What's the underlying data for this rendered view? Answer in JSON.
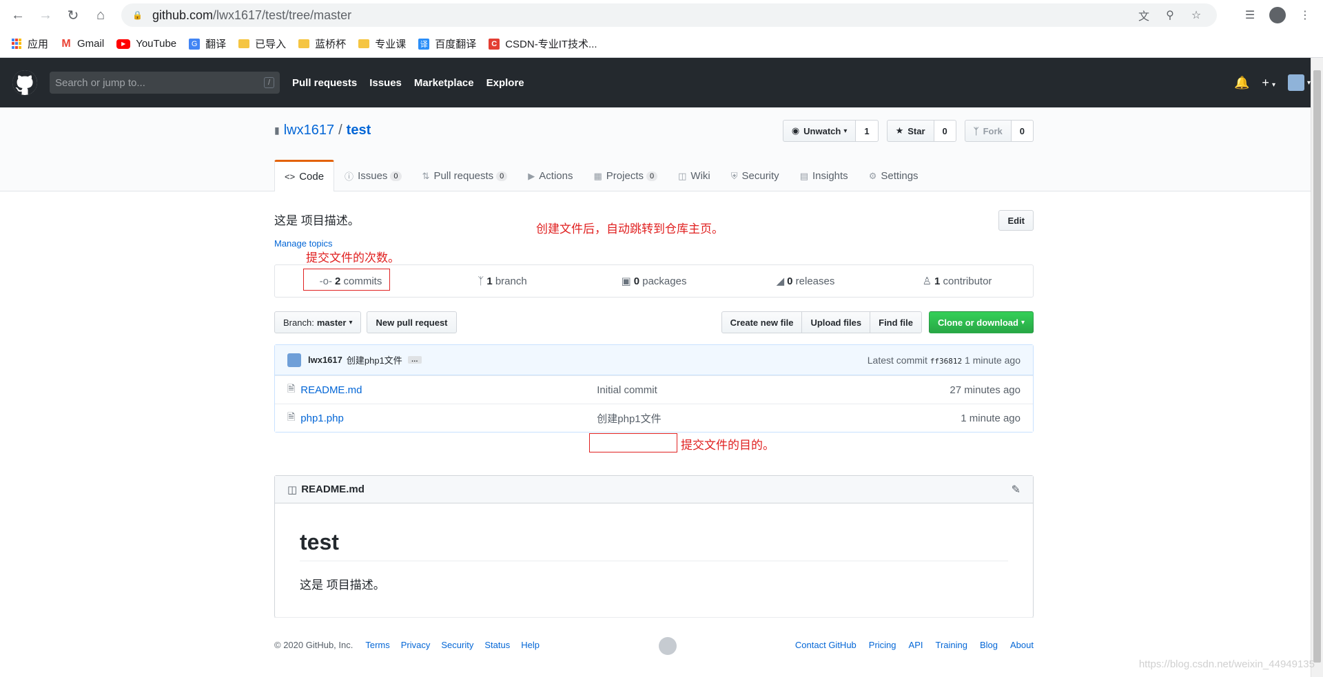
{
  "browser": {
    "url_host": "github.com",
    "url_path": "/lwx1617/test/tree/master",
    "bookmarks": [
      {
        "label": "应用",
        "icon": "apps-icon"
      },
      {
        "label": "Gmail",
        "icon": "gmail-icon"
      },
      {
        "label": "YouTube",
        "icon": "youtube-icon"
      },
      {
        "label": "翻译",
        "icon": "translate-icon"
      },
      {
        "label": "已导入",
        "icon": "folder-icon"
      },
      {
        "label": "蓝桥杯",
        "icon": "folder-icon"
      },
      {
        "label": "专业课",
        "icon": "folder-icon"
      },
      {
        "label": "百度翻译",
        "icon": "baidu-translate-icon"
      },
      {
        "label": "CSDN-专业IT技术...",
        "icon": "csdn-icon"
      }
    ]
  },
  "gh": {
    "search_placeholder": "Search or jump to...",
    "search_shortcut": "/",
    "nav": [
      "Pull requests",
      "Issues",
      "Marketplace",
      "Explore"
    ]
  },
  "repo": {
    "owner": "lwx1617",
    "separator": "/",
    "name": "test",
    "unwatch_label": "Unwatch",
    "watch_count": "1",
    "star_label": "Star",
    "star_count": "0",
    "fork_label": "Fork",
    "fork_count": "0",
    "tabs": {
      "code": "Code",
      "issues": "Issues",
      "issues_count": "0",
      "pulls": "Pull requests",
      "pulls_count": "0",
      "actions": "Actions",
      "projects": "Projects",
      "projects_count": "0",
      "wiki": "Wiki",
      "security": "Security",
      "insights": "Insights",
      "settings": "Settings"
    },
    "description": "这是 项目描述。",
    "edit_label": "Edit",
    "manage_topics": "Manage topics",
    "numbers": {
      "commits_n": "2",
      "commits_label": "commits",
      "branch_n": "1",
      "branch_label": "branch",
      "packages_n": "0",
      "packages_label": "packages",
      "releases_n": "0",
      "releases_label": "releases",
      "contributors_n": "1",
      "contributors_label": "contributor"
    },
    "branch_label": "Branch:",
    "branch_name": "master",
    "new_pr": "New pull request",
    "create_file": "Create new file",
    "upload_files": "Upload files",
    "find_file": "Find file",
    "clone": "Clone or download",
    "latest_commit": {
      "author": "lwx1617",
      "message": "创建php1文件",
      "ellipsis": "…",
      "prefix": "Latest commit",
      "sha": "ff36812",
      "age": "1 minute ago"
    },
    "files": [
      {
        "name": "README.md",
        "message": "Initial commit",
        "age": "27 minutes ago"
      },
      {
        "name": "php1.php",
        "message": "创建php1文件",
        "age": "1 minute ago"
      }
    ],
    "readme": {
      "filename": "README.md",
      "heading": "test",
      "body": "这是 项目描述。"
    }
  },
  "annotations": {
    "redirect": "创建文件后，自动跳转到仓库主页。",
    "commit_count": "提交文件的次数。",
    "commit_purpose": "提交文件的目的。"
  },
  "footer": {
    "copyright": "© 2020 GitHub, Inc.",
    "left_links": [
      "Terms",
      "Privacy",
      "Security",
      "Status",
      "Help"
    ],
    "right_links": [
      "Contact GitHub",
      "Pricing",
      "API",
      "Training",
      "Blog",
      "About"
    ]
  },
  "watermark": "https://blog.csdn.net/weixin_44949135",
  "colors": {
    "accent": "#0366d6",
    "header": "#24292e",
    "annotation": "#e02020",
    "green_button": "#28a745",
    "selected_tab_border": "#e36209"
  }
}
